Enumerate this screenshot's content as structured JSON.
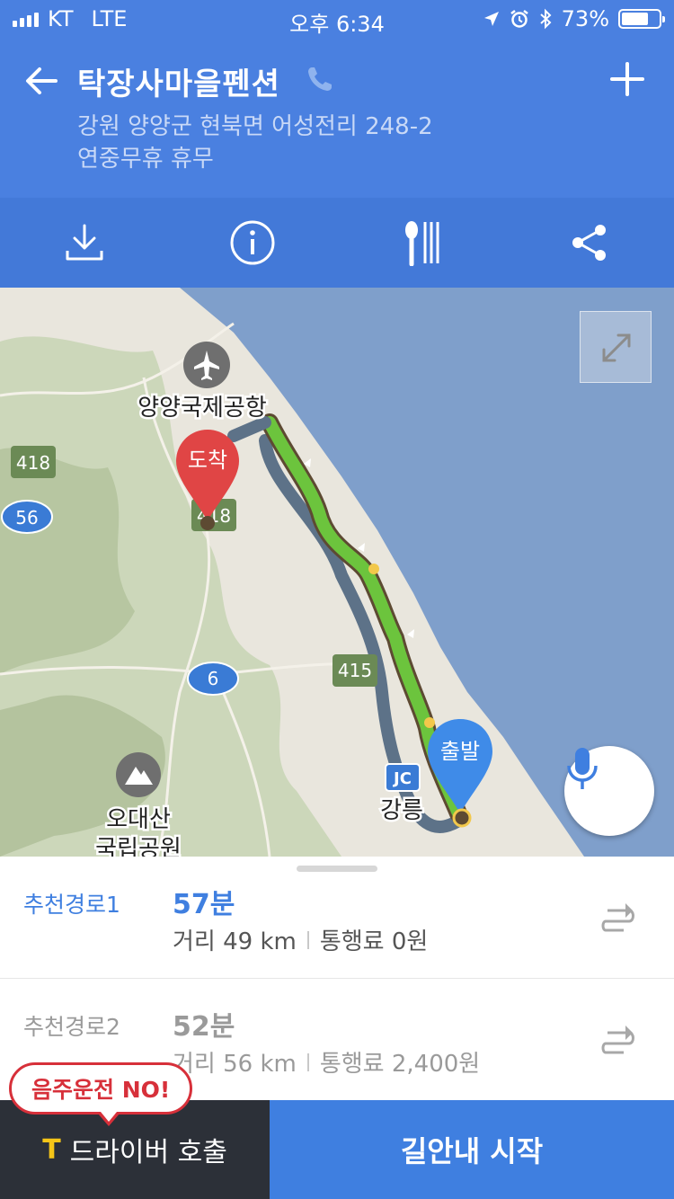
{
  "status_bar": {
    "carrier": "KT",
    "network": "LTE",
    "time": "오후 6:34",
    "battery": "73%",
    "battery_level": 0.73
  },
  "header": {
    "title": "탁장사마을펜션",
    "address": "강원 양양군 현북면 어성전리 248-2",
    "hours": "연중무휴 휴무"
  },
  "toolbar": {
    "icons": [
      "download-icon",
      "info-icon",
      "restaurant-icon",
      "share-icon"
    ]
  },
  "map": {
    "labels": {
      "airport": "양양국제공항",
      "park_line1": "오대산",
      "park_line2": "국립공원",
      "city": "강릉",
      "jc": "JC"
    },
    "shields": {
      "r418a": "418",
      "r418b": "418",
      "r56": "56",
      "r6": "6",
      "r415": "415"
    },
    "markers": {
      "destination": "도착",
      "origin": "출발"
    }
  },
  "routes": [
    {
      "name": "추천경로1",
      "time": "57분",
      "distance": "거리 49 km",
      "toll": "통행료 0원"
    },
    {
      "name": "추천경로2",
      "time": "52분",
      "distance": "거리 56 km",
      "toll": "통행료 2,400원"
    }
  ],
  "footer": {
    "warning": "음주운전 NO!",
    "driver_logo": "T",
    "driver_label": "드라이버 호출",
    "start_label": "길안내 시작"
  },
  "colors": {
    "header_blue": "#4a80e0",
    "accent_blue": "#3f7fe0",
    "route_green": "#6cc43d",
    "route_gray": "#5d7288",
    "destination_red": "#e04545",
    "warning_red": "#d7303a"
  }
}
